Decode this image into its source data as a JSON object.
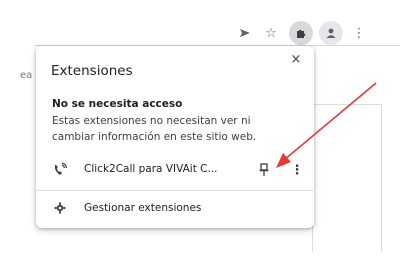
{
  "page": {
    "behind_text": "ea"
  },
  "toolbar": {
    "send_icon": "send-tab-icon",
    "star_icon": "bookmark-star-icon",
    "extensions_icon": "puzzle-icon",
    "profile_icon": "profile-icon",
    "menu_icon": "kebab-menu-icon"
  },
  "popup": {
    "title": "Extensiones",
    "close_glyph": "×",
    "section_heading": "No se necesita acceso",
    "section_description": "Estas extensiones no necesitan ver ni cambiar información en este sitio web.",
    "extension": {
      "name": "Click2Call para VIVAit C...",
      "icon": "click2call-extension-icon",
      "more_glyph": "⋮"
    },
    "manage_label": "Gestionar extensiones",
    "manage_icon": "gear-icon"
  },
  "colors": {
    "accent_arrow": "#e53935",
    "popup_bg": "#ffffff",
    "text": "#202124"
  }
}
